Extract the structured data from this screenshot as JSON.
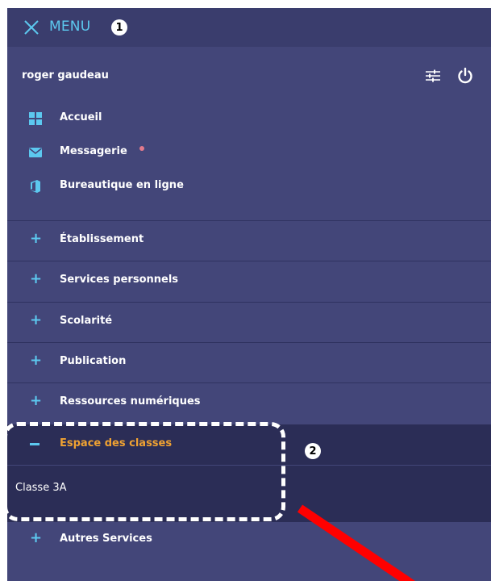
{
  "header": {
    "menu_label": "MENU",
    "close_icon": "close-x-icon",
    "annotation_1": "1"
  },
  "user": {
    "name": "roger gaudeau",
    "settings_icon": "sliders-icon",
    "power_icon": "power-icon"
  },
  "quick_links": [
    {
      "label": "Accueil",
      "icon": "grid-icon"
    },
    {
      "label": "Messagerie",
      "icon": "mail-icon",
      "has_notification": true
    },
    {
      "label": "Bureautique en ligne",
      "icon": "office-icon"
    }
  ],
  "sections": [
    {
      "label": "Établissement",
      "expanded": false
    },
    {
      "label": "Services personnels",
      "expanded": false
    },
    {
      "label": "Scolarité",
      "expanded": false
    },
    {
      "label": "Publication",
      "expanded": false
    },
    {
      "label": "Ressources numériques",
      "expanded": false
    },
    {
      "label": "Espace des classes",
      "expanded": true,
      "children": [
        "Classe 3A"
      ]
    },
    {
      "label": "Autres Services",
      "expanded": false
    }
  ],
  "annotation_2": "2",
  "colors": {
    "panel_bg": "#434679",
    "topbar_bg": "#3a3d6d",
    "active_bg": "#2b2d56",
    "accent_blue": "#5cc8ef",
    "accent_orange": "#f0a232",
    "notification_dot": "#e27a8c",
    "annotation_arrow": "#ff0000"
  }
}
